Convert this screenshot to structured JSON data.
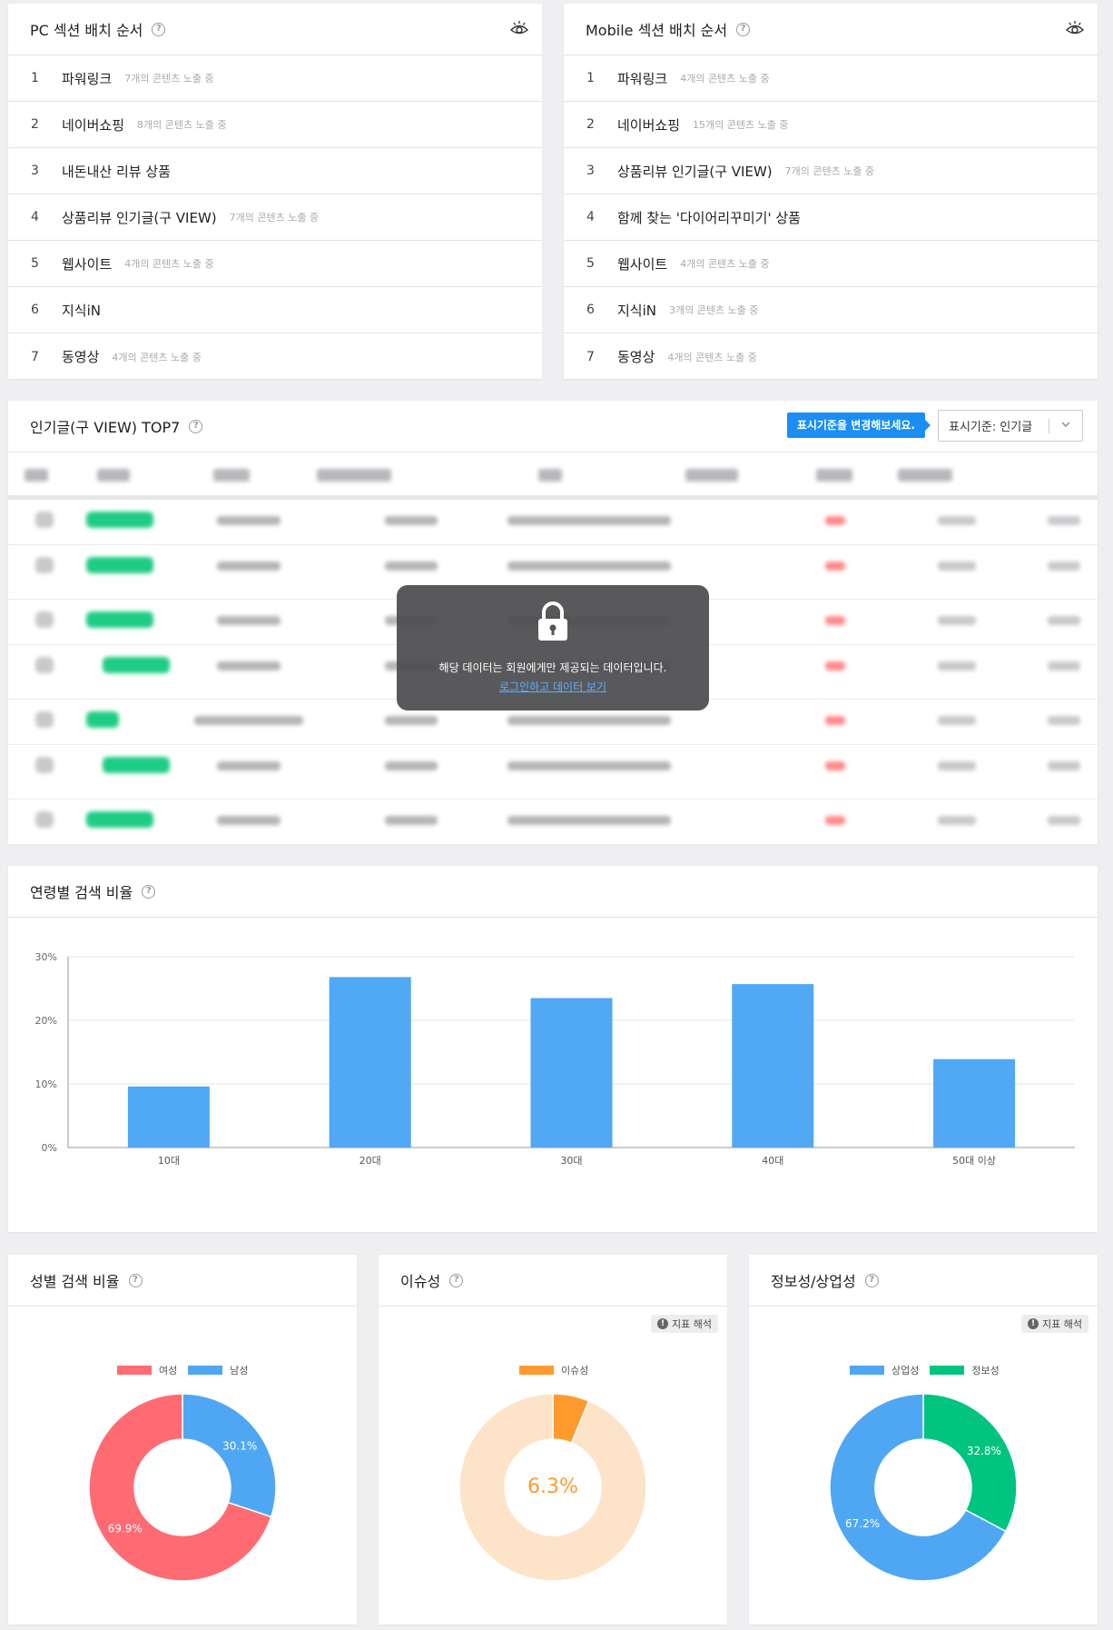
{
  "pc": {
    "title": "PC 섹션 배치 순서",
    "rows": [
      {
        "num": "1",
        "name": "파워링크",
        "count": "7개의 콘텐츠 노출 중"
      },
      {
        "num": "2",
        "name": "네이버쇼핑",
        "count": "8개의 콘텐츠 노출 중"
      },
      {
        "num": "3",
        "name": "내돈내산 리뷰 상품",
        "count": ""
      },
      {
        "num": "4",
        "name": "상품리뷰 인기글(구 VIEW)",
        "count": "7개의 콘텐츠 노출 중"
      },
      {
        "num": "5",
        "name": "웹사이트",
        "count": "4개의 콘텐츠 노출 중"
      },
      {
        "num": "6",
        "name": "지식iN",
        "count": ""
      },
      {
        "num": "7",
        "name": "동영상",
        "count": "4개의 콘텐츠 노출 중"
      }
    ]
  },
  "mobile": {
    "title": "Mobile 섹션 배치 순서",
    "rows": [
      {
        "num": "1",
        "name": "파워링크",
        "count": "4개의 콘텐츠 노출 중"
      },
      {
        "num": "2",
        "name": "네이버쇼핑",
        "count": "15개의 콘텐츠 노출 중"
      },
      {
        "num": "3",
        "name": "상품리뷰 인기글(구 VIEW)",
        "count": "7개의 콘텐츠 노출 중"
      },
      {
        "num": "4",
        "name": "함께 찾는 '다이어리꾸미기' 상품",
        "count": ""
      },
      {
        "num": "5",
        "name": "웹사이트",
        "count": "4개의 콘텐츠 노출 중"
      },
      {
        "num": "6",
        "name": "지식iN",
        "count": "3개의 콘텐츠 노출 중"
      },
      {
        "num": "7",
        "name": "동영상",
        "count": "4개의 콘텐츠 노출 중"
      }
    ]
  },
  "top7": {
    "title": "인기글(구 VIEW) TOP7",
    "tip": "표시기준을 변경해보세요.",
    "select_value": "표시기준: 인기글",
    "lock_message": "해당 데이터는 회원에게만 제공되는 데이터입니다.",
    "lock_link": "로그인하고 데이터 보기"
  },
  "age": {
    "title": "연령별 검색 비율"
  },
  "gender": {
    "title": "성별 검색 비율",
    "legend": [
      "여성",
      "남성"
    ],
    "labels": [
      "30.1%",
      "69.9%"
    ]
  },
  "issue": {
    "title": "이슈성",
    "badge": "지표 해석",
    "legend": [
      "이슈성"
    ],
    "center": "6.3%"
  },
  "info": {
    "title": "정보성/상업성",
    "badge": "지표 해석",
    "legend": [
      "상업성",
      "정보성"
    ],
    "labels": [
      "32.8%",
      "67.2%"
    ]
  },
  "colors": {
    "bar": "#51a8f5",
    "female": "#ff6b72",
    "male": "#4fa7f3",
    "issue": "#ff9a2e",
    "issue_bg": "#fde4c9",
    "commercial": "#4fa7f3",
    "informational": "#00c47f",
    "green_pill": "#1fcc86"
  },
  "chart_data": [
    {
      "type": "bar",
      "categories": [
        "10대",
        "20대",
        "30대",
        "40대",
        "50대 이상"
      ],
      "values": [
        9.6,
        26.8,
        23.5,
        25.7,
        13.9
      ],
      "yticks": [
        "0%",
        "10%",
        "20%",
        "30%"
      ],
      "ylim": [
        0,
        30
      ],
      "grid": true
    },
    {
      "type": "pie",
      "categories": [
        "여성",
        "남성"
      ],
      "values": [
        69.9,
        30.1
      ]
    },
    {
      "type": "pie",
      "categories": [
        "이슈성"
      ],
      "values": [
        6.3
      ]
    },
    {
      "type": "pie",
      "categories": [
        "상업성",
        "정보성"
      ],
      "values": [
        67.2,
        32.8
      ]
    }
  ]
}
